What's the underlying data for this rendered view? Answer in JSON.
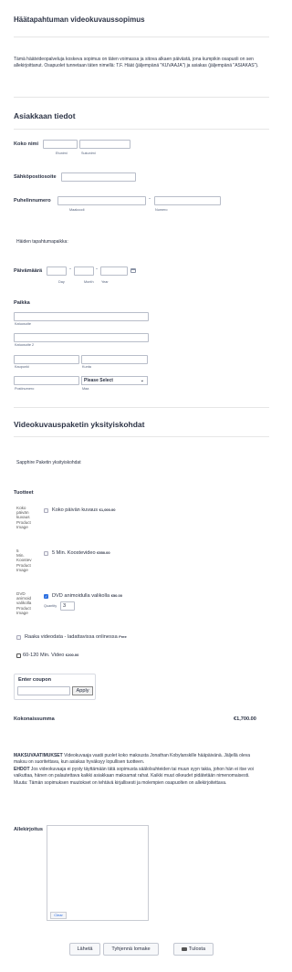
{
  "form_title": "Häätapahtuman videokuvaussopimus",
  "intro": "Tämä häätvideopalveluja koskeva sopimus on täten voimassa ja sitova alkaen päivästä, jona kumpikin osapuoli on sen allekirjoittanut. Osapuolet tunnetaan täten nimellä: T.F. Häät (jäljempänä \"KUVAAJA\") ja asiakas (jäljempänä \"ASIAKAS\").",
  "client_section": {
    "heading": "Asiakkaan tiedot",
    "name_label": "Koko nimi",
    "first_sub": "Etunimi",
    "last_sub": "Sukunimi",
    "email_label": "Sähköpostiosoite",
    "phone_label": "Puhelinnumero",
    "area_sub": "Maakoodi",
    "phone_dash": "-",
    "number_sub": "Numero",
    "wedding_place_q": "Häiden tapahtumapaikka:",
    "date_label": "Päivämäärä",
    "day_sub": "Day",
    "month_sub": "Month",
    "year_sub": "Year",
    "date_dash1": "-",
    "date_dash2": "-",
    "calendar_icon": "calendar-icon",
    "place_label": "Paikka",
    "street_sub": "Katuosoite",
    "street2_sub": "Katuosoite 2",
    "city_sub": "Kaupunki",
    "county_sub": "Kunta",
    "postcode_sub": "Postinumero",
    "country_select_value": "Please Select",
    "country_sub": "Maa"
  },
  "package_section": {
    "heading": "Videokuvauspaketin yksityiskohdat",
    "package_text": "Sapphire Paketin yksityiskohdat",
    "products_label": "Tuotteet",
    "products": [
      {
        "img_alt": [
          "Koko",
          "päivän",
          "kuvaus",
          "Product",
          "Image"
        ],
        "name": "Koko päivän kuvaus",
        "price": "€1,000.00",
        "checked": false
      },
      {
        "img_alt": [
          "5",
          "Min.",
          "Koostev",
          "Product",
          "Image"
        ],
        "name": "5 Min. Koostevideo",
        "price": "€550.00",
        "checked": false
      },
      {
        "img_alt": [
          "DVD",
          "animoid",
          "valikolla",
          "Product",
          "Image"
        ],
        "name": "DVD animoidulla valikolla",
        "price": "€50.00",
        "checked": true,
        "quantity_label": "Quantity",
        "quantity": "3"
      },
      {
        "img_alt": [],
        "name": "Raaka videodata - ladattavissa onlinessa",
        "price": "Free",
        "checked": false
      },
      {
        "img_alt": [],
        "name": "60-120 Min. Video",
        "price": "€200.00",
        "checked": false
      }
    ],
    "coupon_label": "Enter coupon",
    "coupon_apply": "Apply",
    "total_label": "Kokonaissumma",
    "total_value": "€1,700.00"
  },
  "terms": {
    "payment_title": "MAKSUVAATIMUKSET",
    "payment_text": " Videokuvaaja vaatii puolet koko maksusta Jonathan Kobylanskille hääpäivänä. Jäljellä oleva maksu on suoritettava, kun asiakas hyväksyy lopullisen tuotteen.",
    "terms_title": "EHDOT",
    "terms_text": " Jos videokuvaaja ei pysty täyttämään tätä sopimusta säälolsuhteiden tai muun syyn takia, johon hän ei itse voi vaikuttaa, hänen on palautettava kaikki asiakkaan maksamat rahat. Kaikki muut oikeudet pidätetään nimenomaisesti. Muuta: Tämän sopimuksen muutokset on tehtävä kirjallisesti ja molempien osapuolten on allekirjoitettava."
  },
  "signature": {
    "label": "Allekirjoitus",
    "clear": "Clear"
  },
  "buttons": {
    "submit": "Lähetä",
    "reset": "Tyhjennä lomake",
    "print": "Tulosta",
    "print_icon": "printer-icon"
  }
}
